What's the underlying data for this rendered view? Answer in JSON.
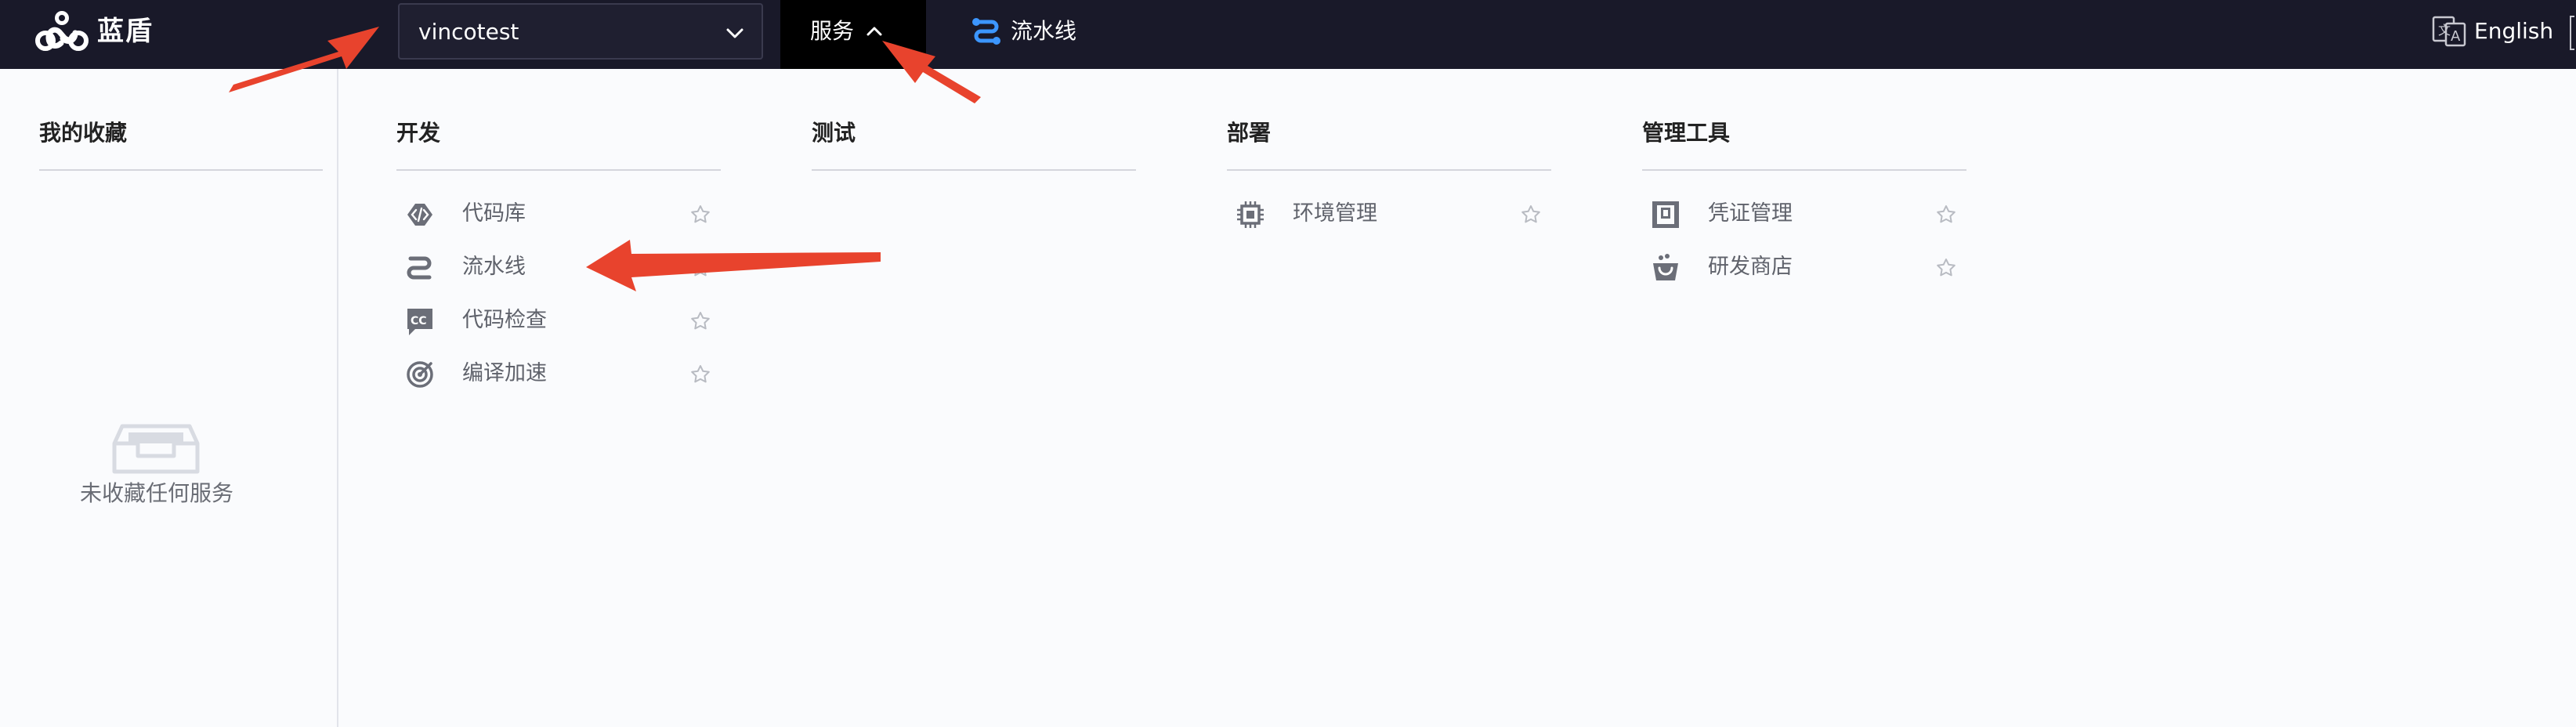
{
  "header": {
    "brand": "蓝盾",
    "project_select": {
      "value": "vincotest"
    },
    "services_menu_label": "服务",
    "pipeline_link_label": "流水线",
    "language_label": "English"
  },
  "favorites": {
    "title": "我的收藏",
    "empty_text": "未收藏任何服务"
  },
  "categories": [
    {
      "title": "开发",
      "items": [
        {
          "label": "代码库",
          "icon": "code-icon"
        },
        {
          "label": "流水线",
          "icon": "pipeline-icon"
        },
        {
          "label": "代码检查",
          "icon": "code-check-icon"
        },
        {
          "label": "编译加速",
          "icon": "accelerate-icon"
        }
      ]
    },
    {
      "title": "测试",
      "items": []
    },
    {
      "title": "部署",
      "items": [
        {
          "label": "环境管理",
          "icon": "chip-icon"
        }
      ]
    },
    {
      "title": "管理工具",
      "items": [
        {
          "label": "凭证管理",
          "icon": "ticket-icon"
        },
        {
          "label": "研发商店",
          "icon": "store-icon"
        }
      ]
    }
  ],
  "colors": {
    "nav_bg": "#191929",
    "active_tab_bg": "#000000",
    "panel_bg": "#fafbfd",
    "accent_blue": "#3c96ff",
    "annotation_red": "#e8432d"
  }
}
